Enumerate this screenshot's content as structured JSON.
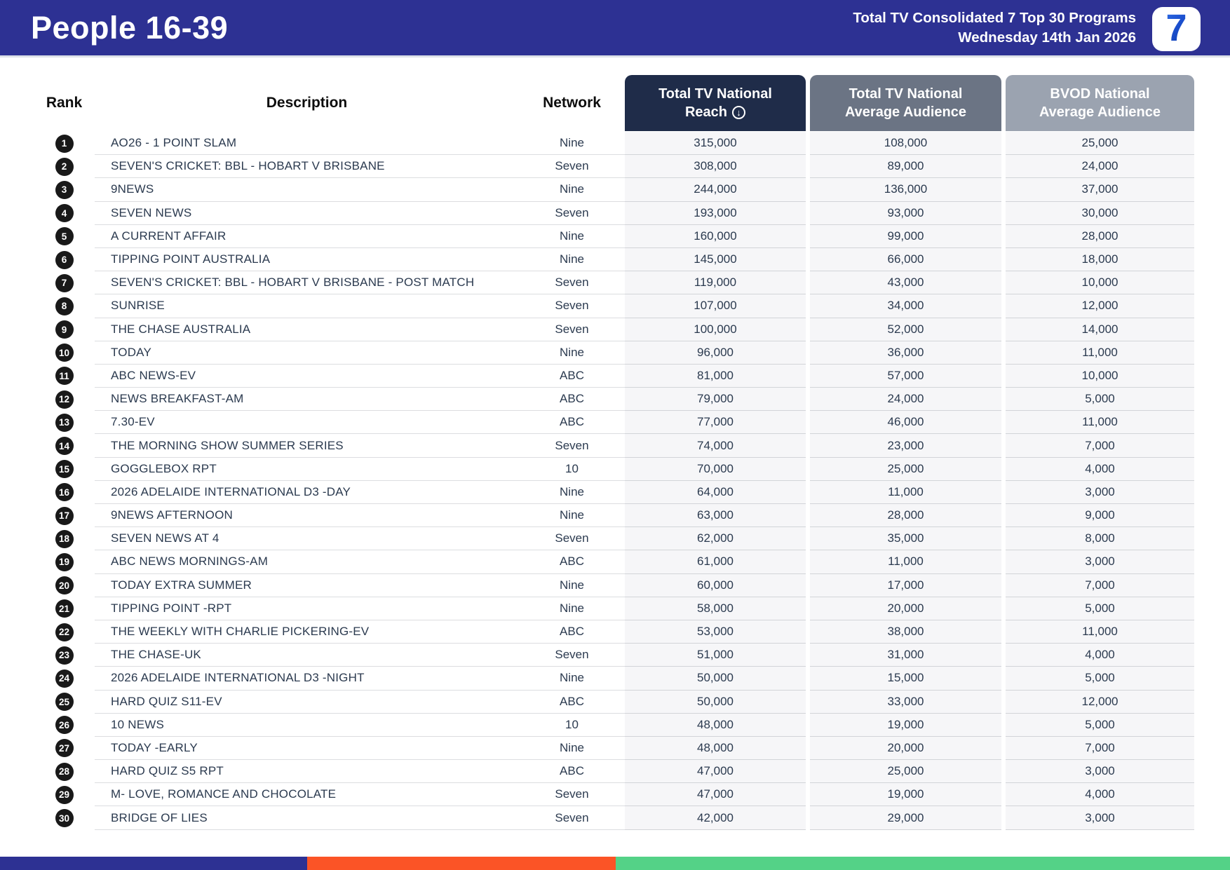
{
  "banner": {
    "title": "People 16-39",
    "report_line1": "Total TV Consolidated 7 Top 30 Programs",
    "report_line2": "Wednesday 14th Jan 2026",
    "logo_glyph": "7"
  },
  "columns": {
    "rank": "Rank",
    "description": "Description",
    "network": "Network"
  },
  "metric_headers": {
    "reach": {
      "line1": "Total TV National",
      "line2": "Reach",
      "sort_icon_glyph": "↓"
    },
    "avg": {
      "line1": "Total TV National",
      "line2": "Average Audience"
    },
    "bvod": {
      "line1": "BVOD National",
      "line2": "Average Audience"
    }
  },
  "colors": {
    "banner_navy": "#2d3193",
    "reach_header_bg": "#1f2c49",
    "avg_header_bg": "#6b7484",
    "bvod_header_bg": "#9ba3b0",
    "row_text": "#2b3a4f",
    "rank_badge_bg": "#191919",
    "numeric_cell_bg": "#f6f6f8",
    "footer_blue": "#2d3193",
    "footer_orange": "#fb5426",
    "footer_green": "#54d287"
  },
  "rows": [
    {
      "rank": "1",
      "description": "AO26 - 1 POINT SLAM",
      "network": "Nine",
      "reach": "315,000",
      "avg_audience": "108,000",
      "bvod_audience": "25,000"
    },
    {
      "rank": "2",
      "description": "SEVEN'S CRICKET: BBL - HOBART V BRISBANE",
      "network": "Seven",
      "reach": "308,000",
      "avg_audience": "89,000",
      "bvod_audience": "24,000"
    },
    {
      "rank": "3",
      "description": "9NEWS",
      "network": "Nine",
      "reach": "244,000",
      "avg_audience": "136,000",
      "bvod_audience": "37,000"
    },
    {
      "rank": "4",
      "description": "SEVEN NEWS",
      "network": "Seven",
      "reach": "193,000",
      "avg_audience": "93,000",
      "bvod_audience": "30,000"
    },
    {
      "rank": "5",
      "description": "A CURRENT AFFAIR",
      "network": "Nine",
      "reach": "160,000",
      "avg_audience": "99,000",
      "bvod_audience": "28,000"
    },
    {
      "rank": "6",
      "description": "TIPPING POINT AUSTRALIA",
      "network": "Nine",
      "reach": "145,000",
      "avg_audience": "66,000",
      "bvod_audience": "18,000"
    },
    {
      "rank": "7",
      "description": "SEVEN'S CRICKET: BBL - HOBART V BRISBANE - POST MATCH",
      "network": "Seven",
      "reach": "119,000",
      "avg_audience": "43,000",
      "bvod_audience": "10,000"
    },
    {
      "rank": "8",
      "description": "SUNRISE",
      "network": "Seven",
      "reach": "107,000",
      "avg_audience": "34,000",
      "bvod_audience": "12,000"
    },
    {
      "rank": "9",
      "description": "THE CHASE AUSTRALIA",
      "network": "Seven",
      "reach": "100,000",
      "avg_audience": "52,000",
      "bvod_audience": "14,000"
    },
    {
      "rank": "10",
      "description": "TODAY",
      "network": "Nine",
      "reach": "96,000",
      "avg_audience": "36,000",
      "bvod_audience": "11,000"
    },
    {
      "rank": "11",
      "description": "ABC NEWS-EV",
      "network": "ABC",
      "reach": "81,000",
      "avg_audience": "57,000",
      "bvod_audience": "10,000"
    },
    {
      "rank": "12",
      "description": "NEWS BREAKFAST-AM",
      "network": "ABC",
      "reach": "79,000",
      "avg_audience": "24,000",
      "bvod_audience": "5,000"
    },
    {
      "rank": "13",
      "description": "7.30-EV",
      "network": "ABC",
      "reach": "77,000",
      "avg_audience": "46,000",
      "bvod_audience": "11,000"
    },
    {
      "rank": "14",
      "description": "THE MORNING SHOW SUMMER SERIES",
      "network": "Seven",
      "reach": "74,000",
      "avg_audience": "23,000",
      "bvod_audience": "7,000"
    },
    {
      "rank": "15",
      "description": "GOGGLEBOX RPT",
      "network": "10",
      "reach": "70,000",
      "avg_audience": "25,000",
      "bvod_audience": "4,000"
    },
    {
      "rank": "16",
      "description": "2026 ADELAIDE INTERNATIONAL D3 -DAY",
      "network": "Nine",
      "reach": "64,000",
      "avg_audience": "11,000",
      "bvod_audience": "3,000"
    },
    {
      "rank": "17",
      "description": "9NEWS AFTERNOON",
      "network": "Nine",
      "reach": "63,000",
      "avg_audience": "28,000",
      "bvod_audience": "9,000"
    },
    {
      "rank": "18",
      "description": "SEVEN NEWS AT 4",
      "network": "Seven",
      "reach": "62,000",
      "avg_audience": "35,000",
      "bvod_audience": "8,000"
    },
    {
      "rank": "19",
      "description": "ABC NEWS MORNINGS-AM",
      "network": "ABC",
      "reach": "61,000",
      "avg_audience": "11,000",
      "bvod_audience": "3,000"
    },
    {
      "rank": "20",
      "description": "TODAY EXTRA SUMMER",
      "network": "Nine",
      "reach": "60,000",
      "avg_audience": "17,000",
      "bvod_audience": "7,000"
    },
    {
      "rank": "21",
      "description": "TIPPING POINT -RPT",
      "network": "Nine",
      "reach": "58,000",
      "avg_audience": "20,000",
      "bvod_audience": "5,000"
    },
    {
      "rank": "22",
      "description": "THE WEEKLY WITH CHARLIE PICKERING-EV",
      "network": "ABC",
      "reach": "53,000",
      "avg_audience": "38,000",
      "bvod_audience": "11,000"
    },
    {
      "rank": "23",
      "description": "THE CHASE-UK",
      "network": "Seven",
      "reach": "51,000",
      "avg_audience": "31,000",
      "bvod_audience": "4,000"
    },
    {
      "rank": "24",
      "description": "2026 ADELAIDE INTERNATIONAL D3 -NIGHT",
      "network": "Nine",
      "reach": "50,000",
      "avg_audience": "15,000",
      "bvod_audience": "5,000"
    },
    {
      "rank": "25",
      "description": "HARD QUIZ S11-EV",
      "network": "ABC",
      "reach": "50,000",
      "avg_audience": "33,000",
      "bvod_audience": "12,000"
    },
    {
      "rank": "26",
      "description": "10 NEWS",
      "network": "10",
      "reach": "48,000",
      "avg_audience": "19,000",
      "bvod_audience": "5,000"
    },
    {
      "rank": "27",
      "description": "TODAY -EARLY",
      "network": "Nine",
      "reach": "48,000",
      "avg_audience": "20,000",
      "bvod_audience": "7,000"
    },
    {
      "rank": "28",
      "description": "HARD QUIZ S5 RPT",
      "network": "ABC",
      "reach": "47,000",
      "avg_audience": "25,000",
      "bvod_audience": "3,000"
    },
    {
      "rank": "29",
      "description": "M- LOVE, ROMANCE AND CHOCOLATE",
      "network": "Seven",
      "reach": "47,000",
      "avg_audience": "19,000",
      "bvod_audience": "4,000"
    },
    {
      "rank": "30",
      "description": "BRIDGE OF LIES",
      "network": "Seven",
      "reach": "42,000",
      "avg_audience": "29,000",
      "bvod_audience": "3,000"
    }
  ]
}
